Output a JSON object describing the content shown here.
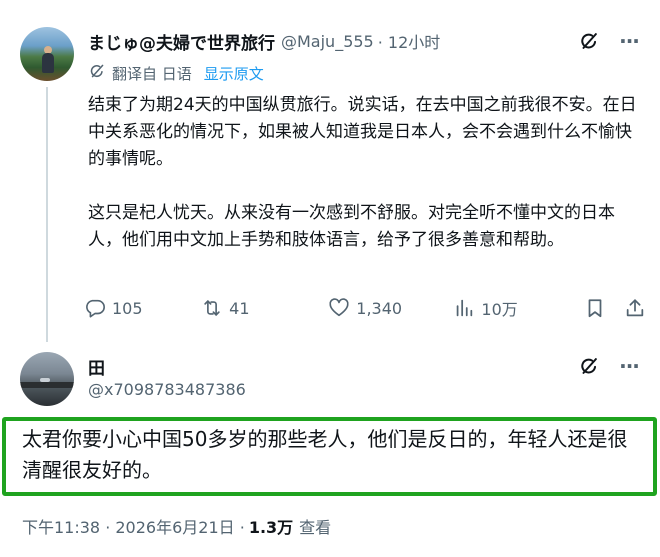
{
  "tweet": {
    "author_name": "まじゅ@夫婦で世界旅行",
    "author_handle": "@Maju_555",
    "time_ago": "· 12小时",
    "translation": {
      "label": "翻译自 日语",
      "show_original": "显示原文"
    },
    "paragraphs": [
      "结束了为期24天的中国纵贯旅行。说实话，在去中国之前我很不安。在日中关系恶化的情况下，如果被人知道我是日本人，会不会遇到什么不愉快的事情呢。",
      "这只是杞人忧天。从来没有一次感到不舒服。对完全听不懂中文的日本人，他们用中文加上手势和肢体语言，给予了很多善意和帮助。"
    ],
    "stats": {
      "replies": "105",
      "reposts": "41",
      "likes": "1,340",
      "views": "10万"
    }
  },
  "reply": {
    "author_name": "田",
    "author_handle": "@x7098783487386",
    "text": "太君你要小心中国50多岁的那些老人，他们是反日的，年轻人还是很清醒很友好的。",
    "timestamp": "下午11:38 · 2026年6月21日 ·",
    "views_count": "1.3万",
    "views_label": "查看"
  },
  "colors": {
    "text_primary": "#0f1419",
    "text_secondary": "#536471",
    "link": "#1d9bf0",
    "highlight_border": "#1fa31f"
  }
}
